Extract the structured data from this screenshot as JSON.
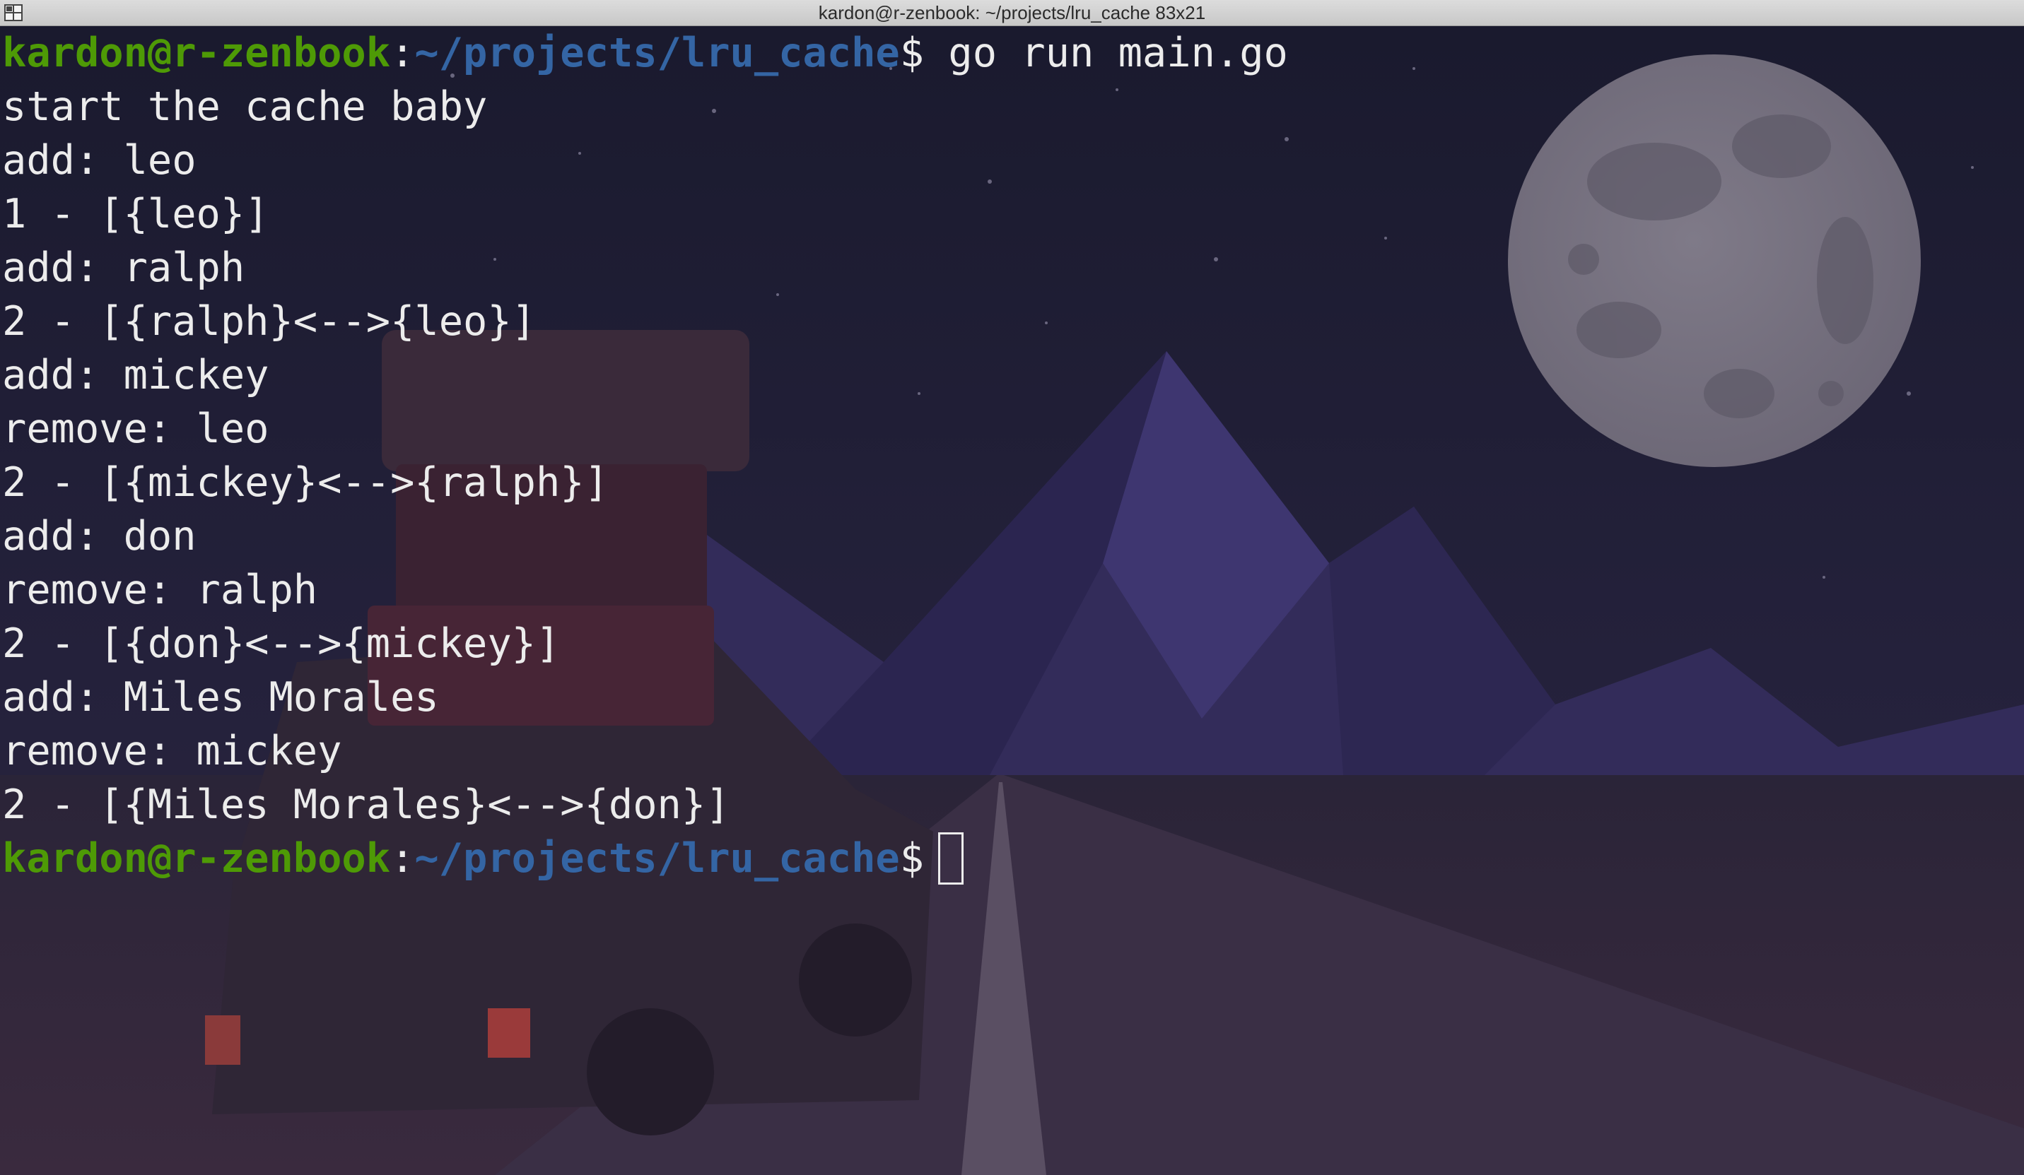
{
  "window": {
    "title": "kardon@r-zenbook: ~/projects/lru_cache 83x21"
  },
  "prompt": {
    "user_host": "kardon@r-zenbook",
    "colon": ":",
    "path": "~/projects/lru_cache",
    "dollar": "$"
  },
  "command": " go run main.go",
  "output": [
    "start the cache baby",
    "add: leo",
    "1 - [{leo}]",
    "add: ralph",
    "2 - [{ralph}<-->{leo}]",
    "add: mickey",
    "remove: leo",
    "2 - [{mickey}<-->{ralph}]",
    "add: don",
    "remove: ralph",
    "2 - [{don}<-->{mickey}]",
    "add: Miles Morales",
    "remove: mickey",
    "2 - [{Miles Morales}<-->{don}]"
  ],
  "colors": {
    "prompt_user": "#4e9a06",
    "prompt_path": "#3465a4",
    "text": "#ececec"
  },
  "icons": {
    "window": "window-menu-icon"
  }
}
